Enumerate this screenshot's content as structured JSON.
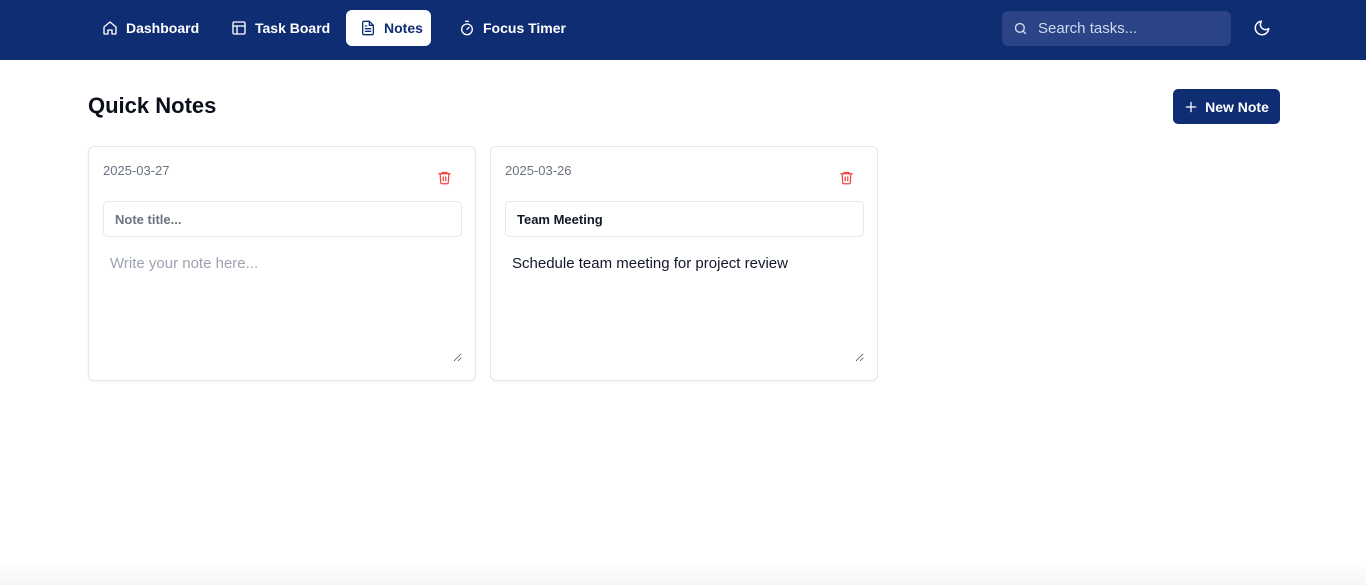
{
  "nav": {
    "items": [
      {
        "label": "Dashboard",
        "icon": "home-icon",
        "active": false
      },
      {
        "label": "Task Board",
        "icon": "board-icon",
        "active": false
      },
      {
        "label": "Notes",
        "icon": "document-icon",
        "active": true
      },
      {
        "label": "Focus Timer",
        "icon": "timer-icon",
        "active": false
      }
    ],
    "search": {
      "placeholder": "Search tasks...",
      "value": "",
      "icon": "search-icon"
    },
    "theme_toggle_icon": "moon-icon"
  },
  "page": {
    "title": "Quick Notes",
    "new_note_label": "New Note"
  },
  "notes": [
    {
      "date": "2025-03-27",
      "title": "",
      "title_placeholder": "Note title...",
      "body": "",
      "body_placeholder": "Write your note here..."
    },
    {
      "date": "2025-03-26",
      "title": "Team Meeting",
      "title_placeholder": "Note title...",
      "body": "Schedule team meeting for project review",
      "body_placeholder": "Write your note here..."
    }
  ],
  "colors": {
    "primary": "#0f2d73",
    "delete": "#ef4444",
    "card_border": "#e5e7eb"
  }
}
